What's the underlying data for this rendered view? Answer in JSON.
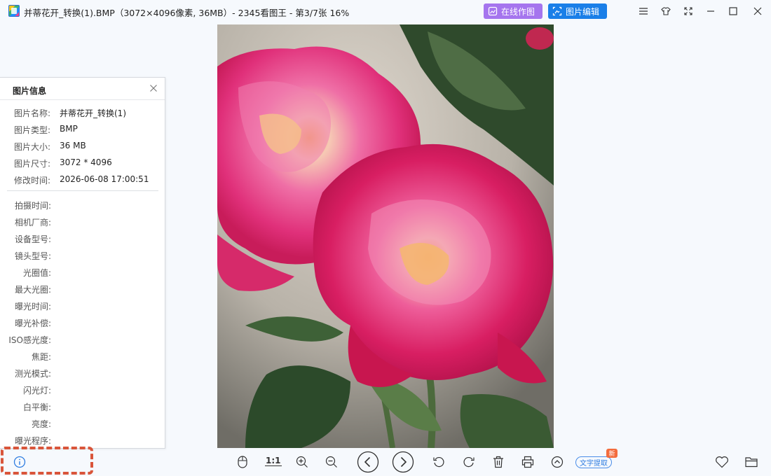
{
  "window": {
    "title": "并蒂花开_转换(1).BMP（3072×4096像素, 36MB）- 2345看图王 - 第3/7张 16%",
    "app_icon": "2345-viewer-icon"
  },
  "header_buttons": {
    "online_draw": "在线作图",
    "image_edit": "图片编辑",
    "online_draw_color": "#a575ee",
    "image_edit_color": "#1a7fe8"
  },
  "window_controls": [
    "menu-icon",
    "skin-icon",
    "fullscreen-icon",
    "minimize-icon",
    "maximize-icon",
    "close-icon"
  ],
  "info_panel": {
    "title": "图片信息",
    "basic": [
      {
        "label": "图片名称:",
        "value": "并蒂花开_转换(1)"
      },
      {
        "label": "图片类型:",
        "value": "BMP"
      },
      {
        "label": "图片大小:",
        "value": "36 MB"
      },
      {
        "label": "图片尺寸:",
        "value": "3072 * 4096"
      },
      {
        "label": "修改时间:",
        "value": "2026-06-08 17:00:51"
      }
    ],
    "exif": [
      "拍摄时间:",
      "相机厂商:",
      "设备型号:",
      "镜头型号:",
      "光圈值:",
      "最大光圈:",
      "曝光时间:",
      "曝光补偿:",
      "ISO感光度:",
      "焦距:",
      "测光模式:",
      "闪光灯:",
      "白平衡:",
      "亮度:",
      "曝光程序:"
    ]
  },
  "toolbar": {
    "actual_size_label": "1:1",
    "ocr_label": "文字提取",
    "new_badge": "新",
    "accent_color": "#d9553a"
  }
}
